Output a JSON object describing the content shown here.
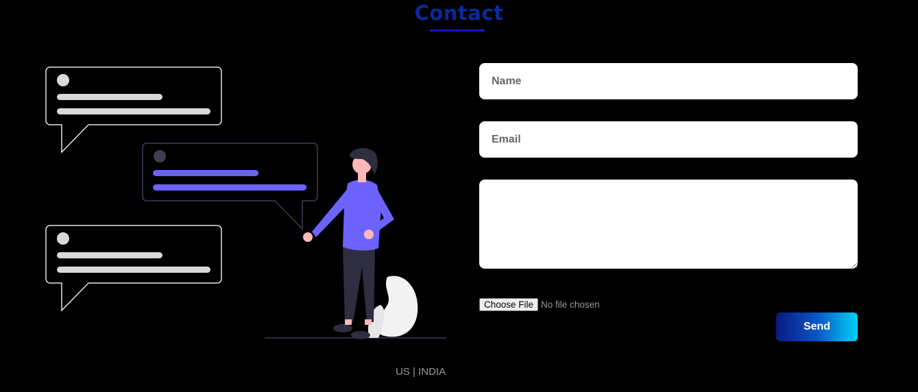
{
  "header": {
    "title": "Contact"
  },
  "form": {
    "name_placeholder": "Name",
    "email_placeholder": "Email",
    "message_placeholder": "",
    "file_button_label": "Choose File",
    "file_status": "No file chosen",
    "send_label": "Send"
  },
  "footer": {
    "locations": "US | INDIA"
  },
  "colors": {
    "background": "#000000",
    "title": "#0a2a9a",
    "underline": "#1a12d6",
    "accent_purple": "#6c63ff",
    "send_gradient_start": "#0a1a80",
    "send_gradient_end": "#00d2f5"
  }
}
